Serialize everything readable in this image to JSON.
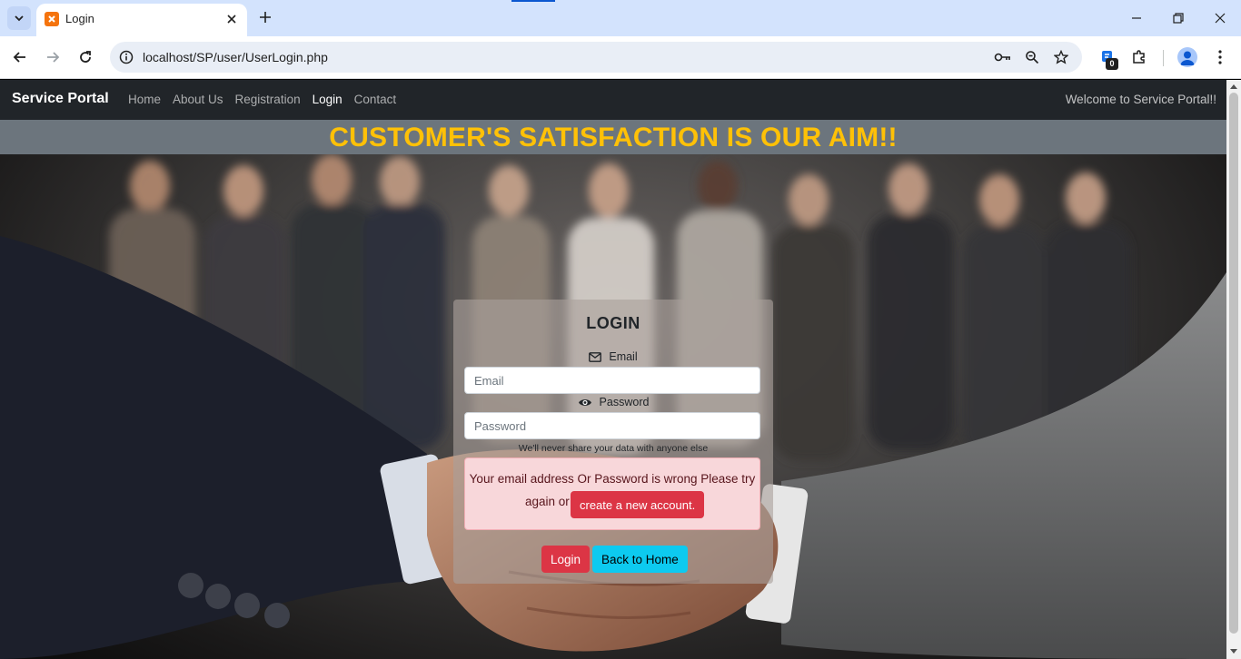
{
  "browser": {
    "tab_title": "Login",
    "url": "localhost/SP/user/UserLogin.php",
    "extension_badge": "0"
  },
  "navbar": {
    "brand": "Service Portal",
    "links": [
      {
        "label": "Home",
        "active": false
      },
      {
        "label": "About Us",
        "active": false
      },
      {
        "label": "Registration",
        "active": false
      },
      {
        "label": "Login",
        "active": true
      },
      {
        "label": "Contact",
        "active": false
      }
    ],
    "welcome": "Welcome to Service Portal!!"
  },
  "banner": {
    "text": "CUSTOMER'S SATISFACTION IS OUR AIM!!"
  },
  "login_form": {
    "title": "LOGIN",
    "email_label": "Email",
    "email_placeholder": "Email",
    "email_value": "",
    "password_label": "Password",
    "password_placeholder": "Password",
    "password_value": "",
    "help_text": "We'll never share your data with anyone else",
    "alert_line1": "Your email address Or Password is wrong Please try",
    "alert_line2": "again or",
    "alert_link": "create a new account.",
    "login_button": "Login",
    "home_button": "Back to Home"
  },
  "colors": {
    "navbar_bg": "#212529",
    "banner_bg": "#6c757d",
    "banner_text": "#ffc107",
    "danger": "#dc3545",
    "info": "#0dcaf0",
    "alert_bg": "#f8d7da"
  },
  "icons": {
    "email": "envelope-icon",
    "password": "eye-icon"
  }
}
